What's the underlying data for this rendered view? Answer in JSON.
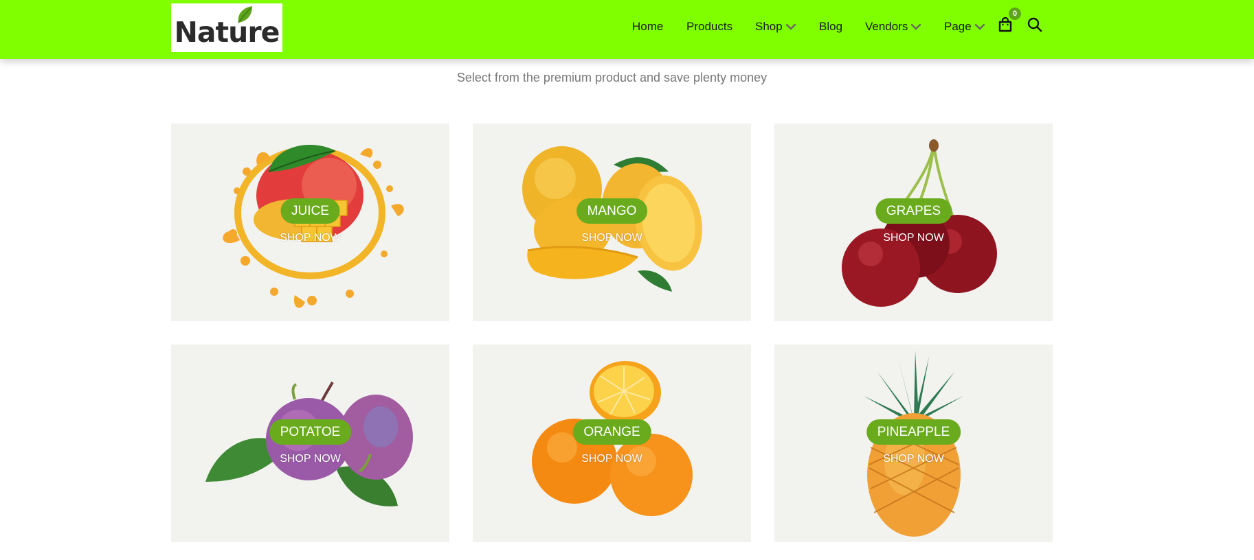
{
  "brand": {
    "logo_text_a": "Nat",
    "logo_text_b": "u",
    "logo_text_c": "re",
    "header_color": "#7fff00",
    "accent_color": "#6aab1e"
  },
  "nav": {
    "items": [
      {
        "label": "Home",
        "has_dropdown": false
      },
      {
        "label": "Products",
        "has_dropdown": false
      },
      {
        "label": "Shop",
        "has_dropdown": true
      },
      {
        "label": "Blog",
        "has_dropdown": false
      },
      {
        "label": "Vendors",
        "has_dropdown": true
      },
      {
        "label": "Page",
        "has_dropdown": true
      }
    ],
    "cart_icon": "shopping-bag-icon",
    "cart_count": "0",
    "search_icon": "search-icon"
  },
  "section": {
    "subtitle": "Select from the premium product and save plenty money"
  },
  "categories": [
    {
      "label": "JUICE",
      "cta": "SHOP NOW",
      "image": "mango-juice-splash"
    },
    {
      "label": "MANGO",
      "cta": "SHOP NOW",
      "image": "mangoes"
    },
    {
      "label": "GRAPES",
      "cta": "SHOP NOW",
      "image": "cherries"
    },
    {
      "label": "POTATOE",
      "cta": "SHOP NOW",
      "image": "plums-with-leaves"
    },
    {
      "label": "ORANGE",
      "cta": "SHOP NOW",
      "image": "oranges"
    },
    {
      "label": "PINEAPPLE",
      "cta": "SHOP NOW",
      "image": "pineapple"
    }
  ]
}
